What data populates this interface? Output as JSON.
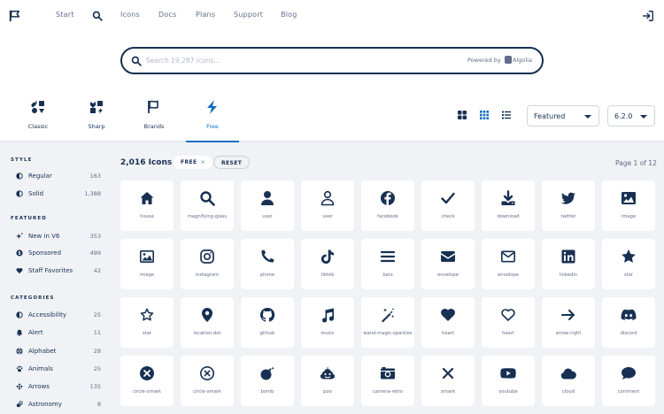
{
  "nav": {
    "items": [
      "Start",
      "Icons",
      "Docs",
      "Plans",
      "Support",
      "Blog"
    ]
  },
  "search": {
    "placeholder": "Search 19,287 icons...",
    "powered_by": "Powered by",
    "provider": "Algolia"
  },
  "family_tabs": [
    {
      "label": "Classic",
      "icon": "classic-icons"
    },
    {
      "label": "Sharp",
      "icon": "sharp-icons"
    },
    {
      "label": "Brands",
      "icon": "flag"
    },
    {
      "label": "Free",
      "icon": "bolt",
      "active": true
    }
  ],
  "view_modes": [
    "grid-large",
    "grid-small",
    "list"
  ],
  "sort_select": {
    "value": "Featured"
  },
  "version_select": {
    "value": "6.2.0"
  },
  "sidebar": {
    "style_title": "STYLE",
    "style_items": [
      {
        "label": "Regular",
        "count": "163",
        "icon": "circle-half"
      },
      {
        "label": "Solid",
        "count": "1,388",
        "icon": "circle-half"
      }
    ],
    "featured_title": "FEATURED",
    "featured_items": [
      {
        "label": "New in V6",
        "count": "353",
        "icon": "sparkles"
      },
      {
        "label": "Sponsored",
        "count": "499",
        "icon": "badge-dollar"
      },
      {
        "label": "Staff Favorites",
        "count": "42",
        "icon": "heart"
      }
    ],
    "categories_title": "CATEGORIES",
    "category_items": [
      {
        "label": "Accessibility",
        "count": "25",
        "icon": "circle-half"
      },
      {
        "label": "Alert",
        "count": "11",
        "icon": "bell"
      },
      {
        "label": "Alphabet",
        "count": "28",
        "icon": "globe"
      },
      {
        "label": "Animals",
        "count": "25",
        "icon": "paw"
      },
      {
        "label": "Arrows",
        "count": "135",
        "icon": "arrows"
      },
      {
        "label": "Astronomy",
        "count": "8",
        "icon": "meteor"
      }
    ]
  },
  "results": {
    "count_label": "2,016 Icons",
    "filter_pill": "FREE",
    "filter_remove": "×",
    "reset_label": "RESET",
    "page_info": "Page 1 of 12"
  },
  "icons": [
    {
      "name": "house",
      "icon": "house"
    },
    {
      "name": "magnifying-glass",
      "icon": "magnifying-glass"
    },
    {
      "name": "user",
      "icon": "user-solid"
    },
    {
      "name": "user",
      "icon": "user-regular"
    },
    {
      "name": "facebook",
      "icon": "facebook"
    },
    {
      "name": "check",
      "icon": "check"
    },
    {
      "name": "download",
      "icon": "download"
    },
    {
      "name": "twitter",
      "icon": "twitter"
    },
    {
      "name": "image",
      "icon": "image-solid"
    },
    {
      "name": "image",
      "icon": "image-regular"
    },
    {
      "name": "instagram",
      "icon": "instagram"
    },
    {
      "name": "phone",
      "icon": "phone"
    },
    {
      "name": "tiktok",
      "icon": "tiktok"
    },
    {
      "name": "bars",
      "icon": "bars"
    },
    {
      "name": "envelope",
      "icon": "envelope-solid"
    },
    {
      "name": "envelope",
      "icon": "envelope-regular"
    },
    {
      "name": "linkedin",
      "icon": "linkedin"
    },
    {
      "name": "star",
      "icon": "star-solid"
    },
    {
      "name": "star",
      "icon": "star-regular"
    },
    {
      "name": "location-dot",
      "icon": "location-dot"
    },
    {
      "name": "github",
      "icon": "github"
    },
    {
      "name": "music",
      "icon": "music"
    },
    {
      "name": "wand-magic-sparkles",
      "icon": "wand"
    },
    {
      "name": "heart",
      "icon": "heart-solid"
    },
    {
      "name": "heart",
      "icon": "heart-regular"
    },
    {
      "name": "arrow-right",
      "icon": "arrow-right"
    },
    {
      "name": "discord",
      "icon": "discord"
    },
    {
      "name": "circle-xmark",
      "icon": "circle-xmark-solid"
    },
    {
      "name": "circle-xmark",
      "icon": "circle-xmark-regular"
    },
    {
      "name": "bomb",
      "icon": "bomb"
    },
    {
      "name": "poo",
      "icon": "poo"
    },
    {
      "name": "camera-retro",
      "icon": "camera-retro"
    },
    {
      "name": "xmark",
      "icon": "xmark"
    },
    {
      "name": "youtube",
      "icon": "youtube"
    },
    {
      "name": "cloud",
      "icon": "cloud"
    },
    {
      "name": "comment",
      "icon": "comment"
    }
  ],
  "colors": {
    "primary": "#183153",
    "accent": "#146ebe",
    "muted": "#616d8a",
    "background": "#f0f2f5"
  }
}
